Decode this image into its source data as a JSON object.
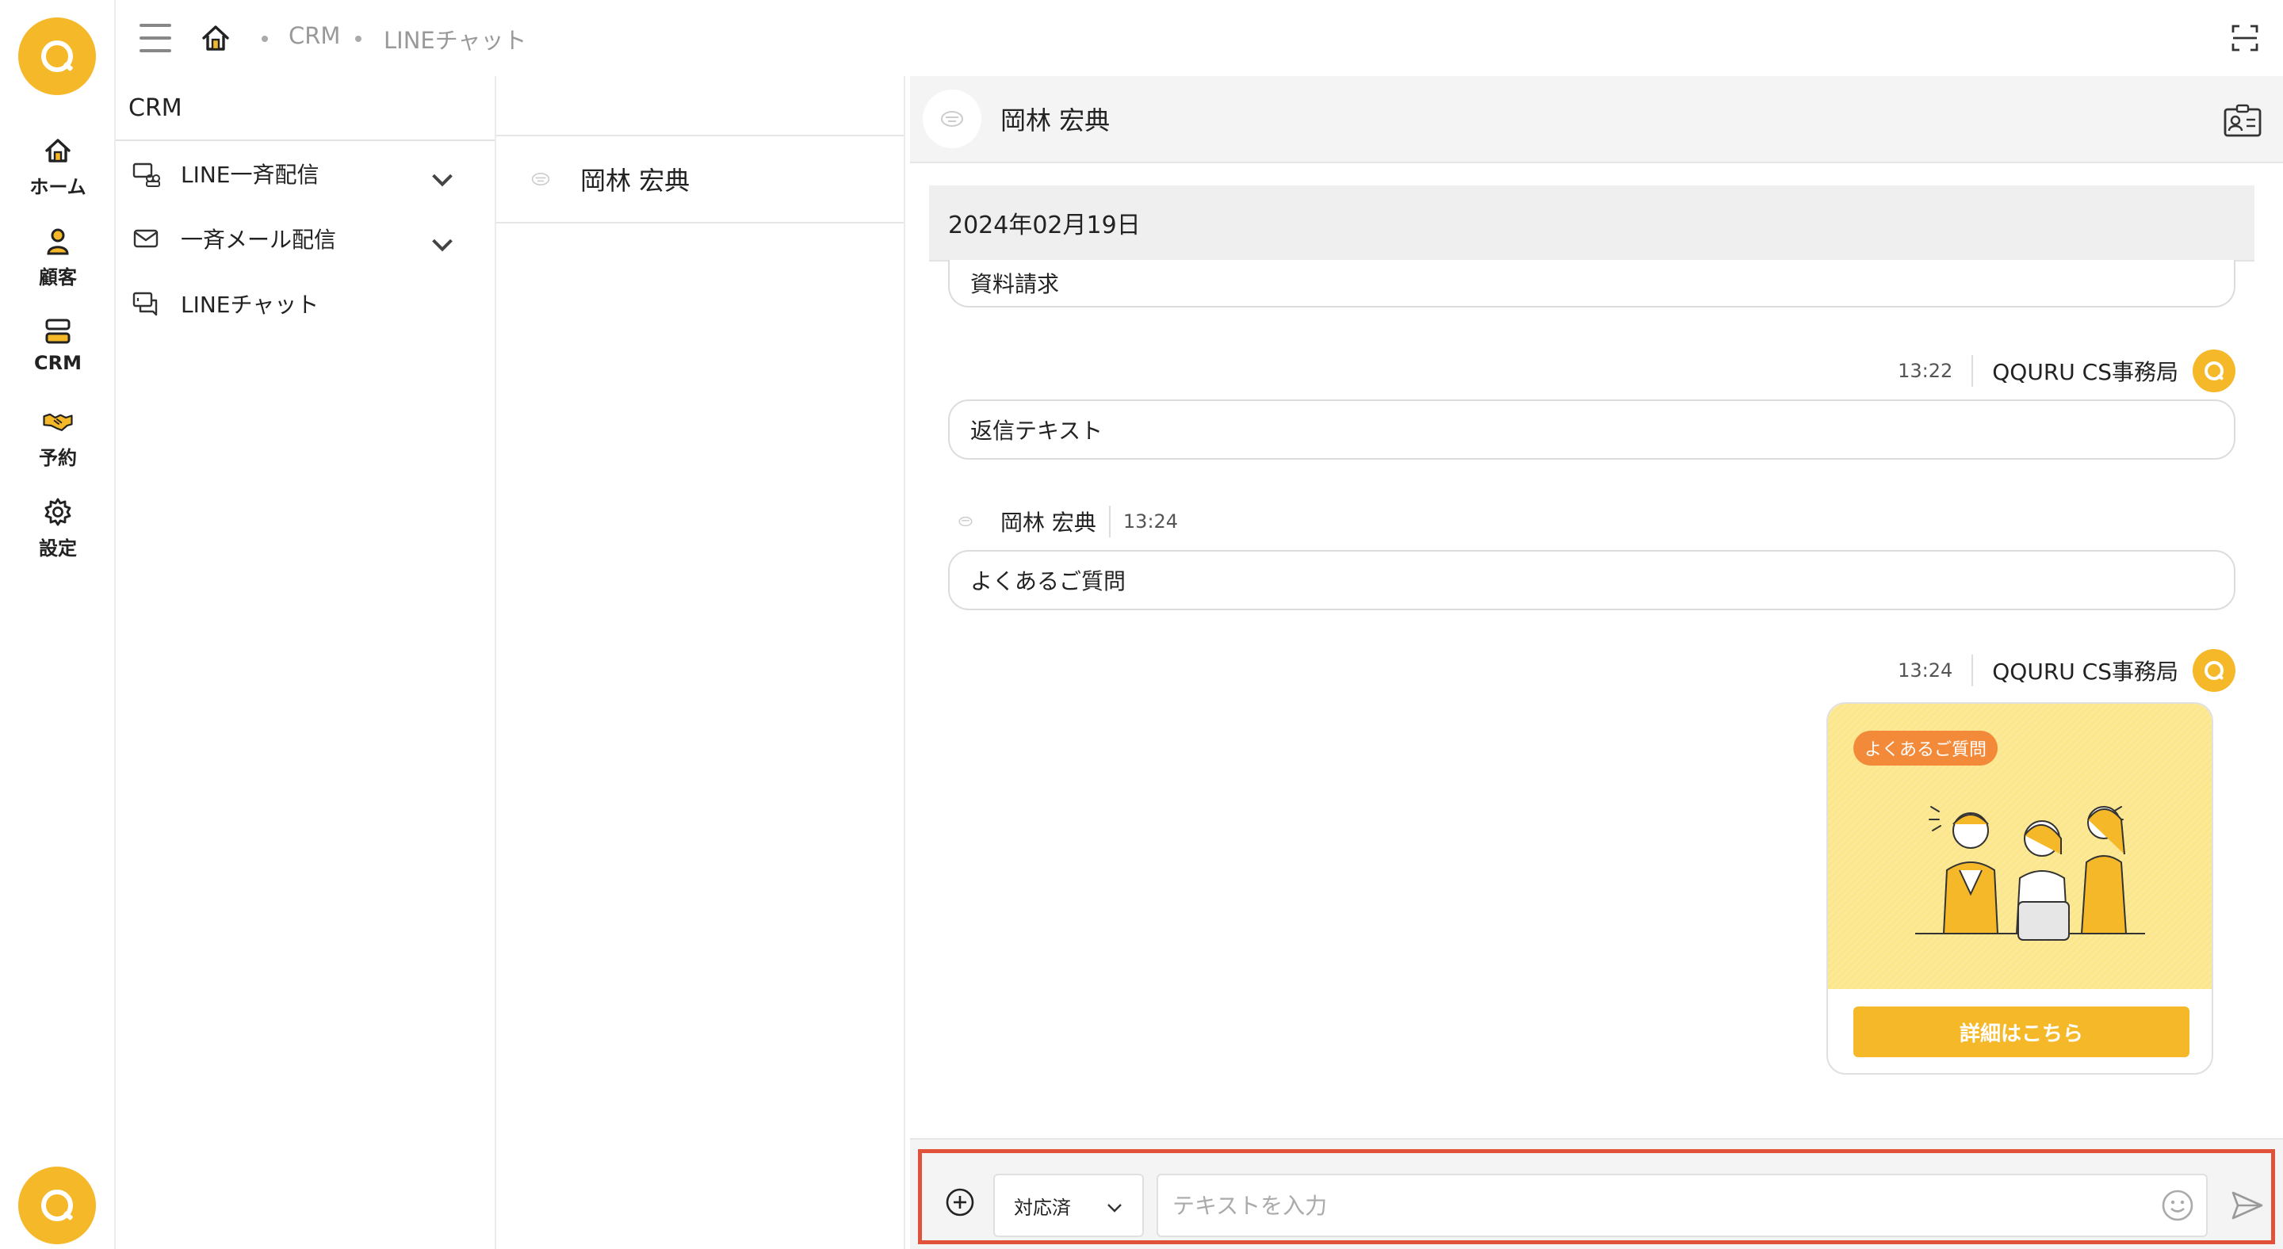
{
  "app": {
    "brand_color": "#f5b829"
  },
  "rail": {
    "items": [
      {
        "label": "ホーム",
        "icon": "home-icon"
      },
      {
        "label": "顧客",
        "icon": "person-icon"
      },
      {
        "label": "CRM",
        "icon": "crm-icon"
      },
      {
        "label": "予約",
        "icon": "handshake-icon"
      },
      {
        "label": "設定",
        "icon": "gear-icon"
      }
    ]
  },
  "breadcrumb": {
    "items": [
      "CRM",
      "LINEチャット"
    ]
  },
  "menu": {
    "title": "CRM",
    "items": [
      {
        "label": "LINE一斉配信",
        "icon": "line-broadcast-icon",
        "expandable": true
      },
      {
        "label": "一斉メール配信",
        "icon": "mail-icon",
        "expandable": true
      },
      {
        "label": "LINEチャット",
        "icon": "chat-icon",
        "expandable": false
      }
    ]
  },
  "conversations": [
    {
      "name": "岡林 宏典"
    }
  ],
  "chat": {
    "contact_name": "岡林 宏典",
    "date": "2024年02月19日",
    "messages": [
      {
        "text": "資料請求"
      },
      {
        "time": "13:22",
        "sender": "QQURU CS事務局",
        "text": "返信テキスト"
      },
      {
        "sender": "岡林 宏典",
        "time": "13:24",
        "text": "よくあるご質問"
      },
      {
        "time": "13:24",
        "sender": "QQURU CS事務局",
        "card": {
          "tag": "よくあるご質問",
          "button": "詳細はこちら"
        }
      }
    ]
  },
  "composer": {
    "status": "対応済",
    "placeholder": "テキストを入力",
    "value": ""
  }
}
